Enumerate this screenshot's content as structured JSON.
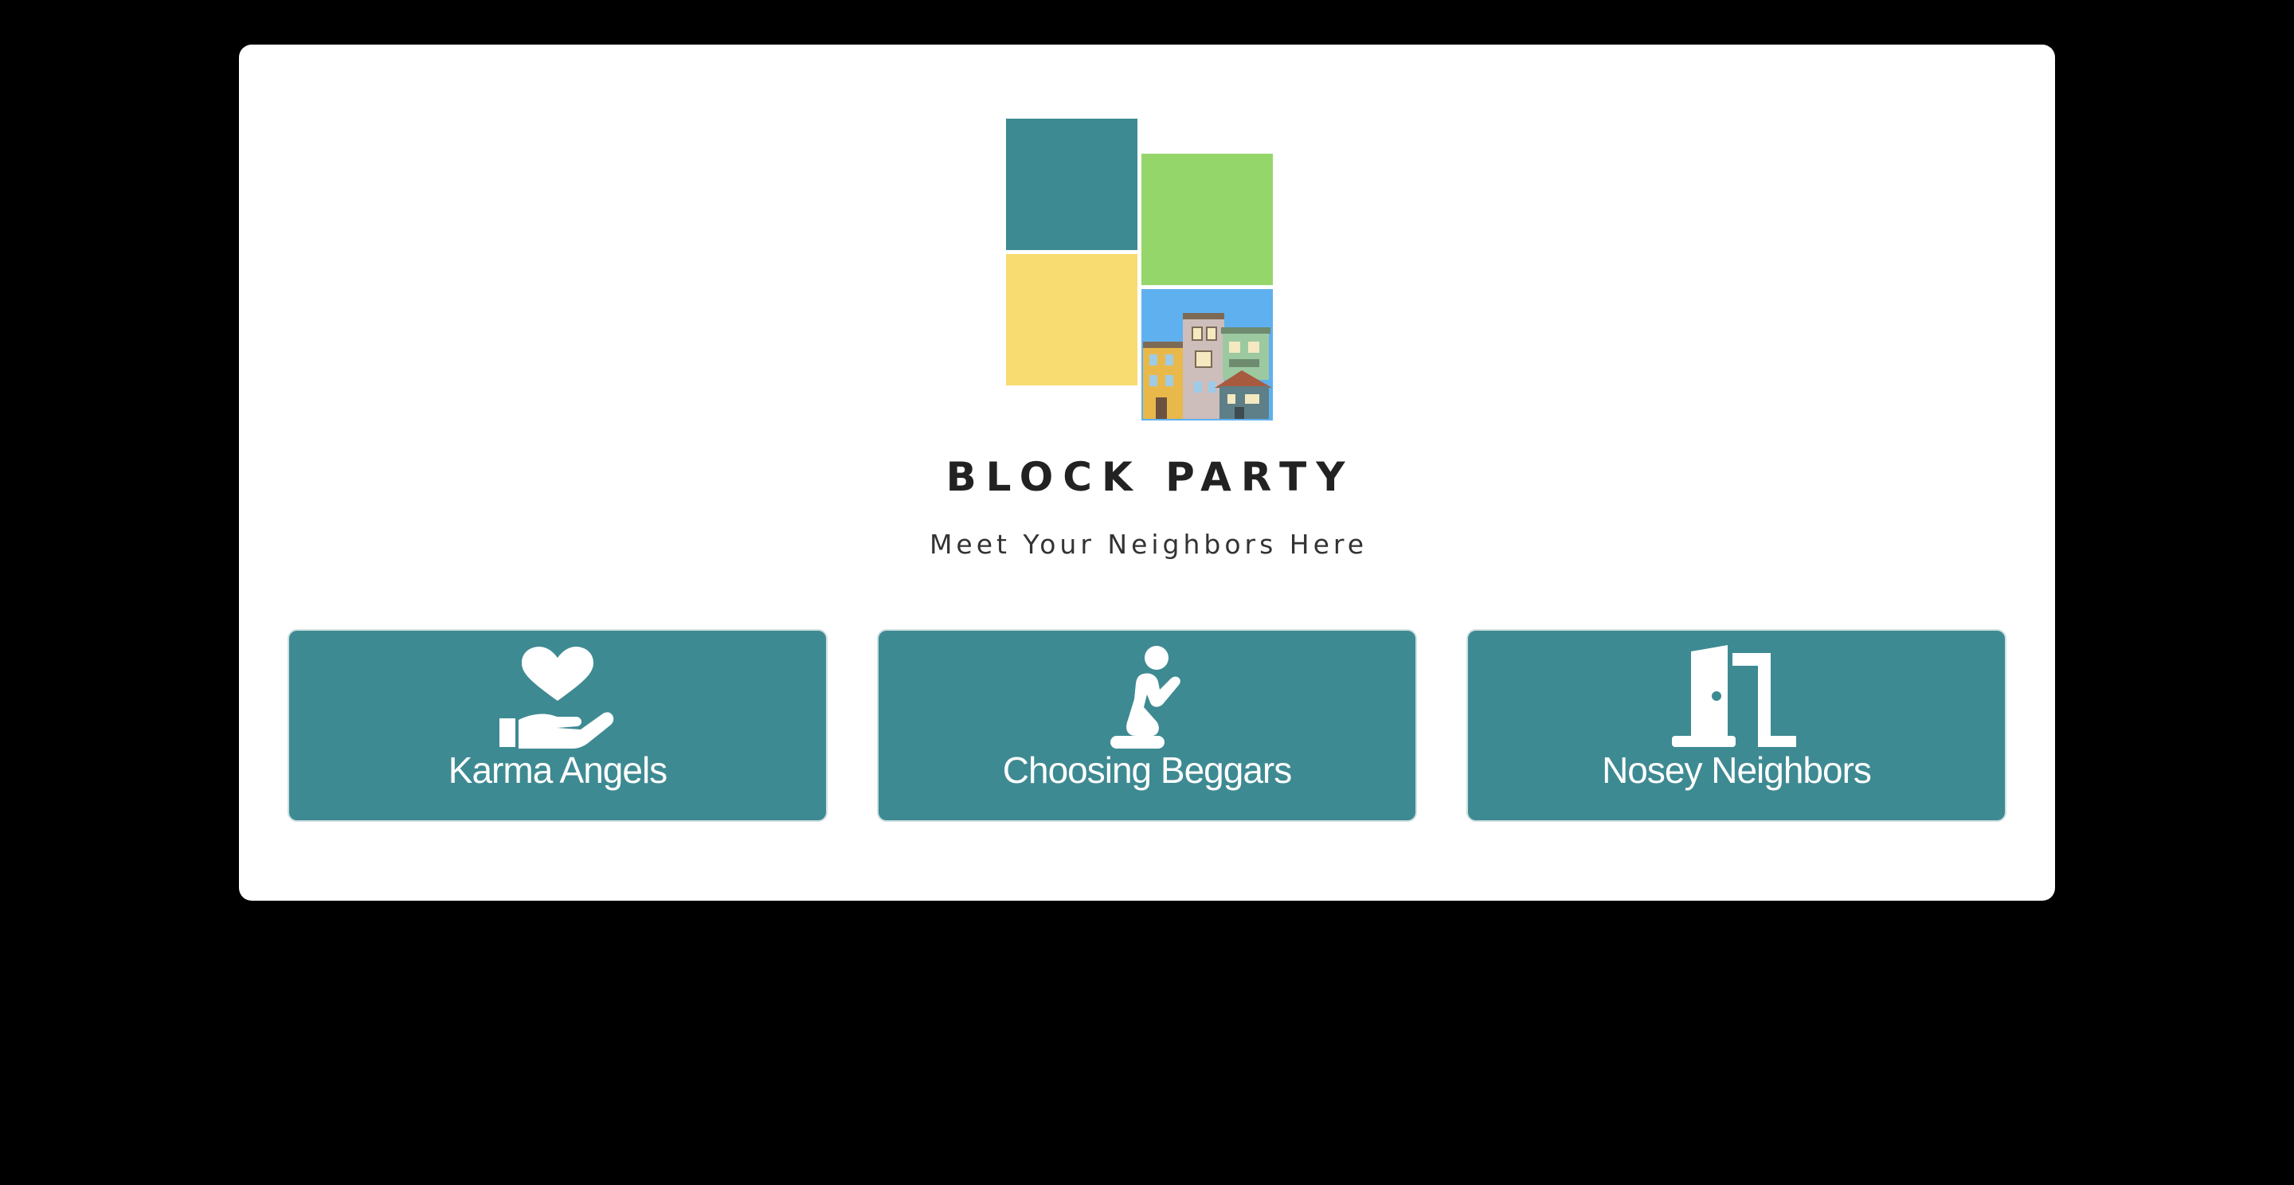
{
  "brand": {
    "title": "BLOCK PARTY",
    "tagline": "Meet Your Neighbors Here",
    "logo_colors": {
      "teal": "#3e8a92",
      "green": "#95d66b",
      "yellow": "#f8dc72",
      "sky": "#5fb0ee"
    }
  },
  "tiles": [
    {
      "label": "Karma Angels",
      "icon": "heart-in-hand-icon"
    },
    {
      "label": "Choosing Beggars",
      "icon": "kneeling-person-icon"
    },
    {
      "label": "Nosey Neighbors",
      "icon": "open-door-icon"
    }
  ],
  "colors": {
    "background": "#000000",
    "card": "#ffffff",
    "tile": "#3e8a92",
    "tile_text": "#ffffff"
  }
}
